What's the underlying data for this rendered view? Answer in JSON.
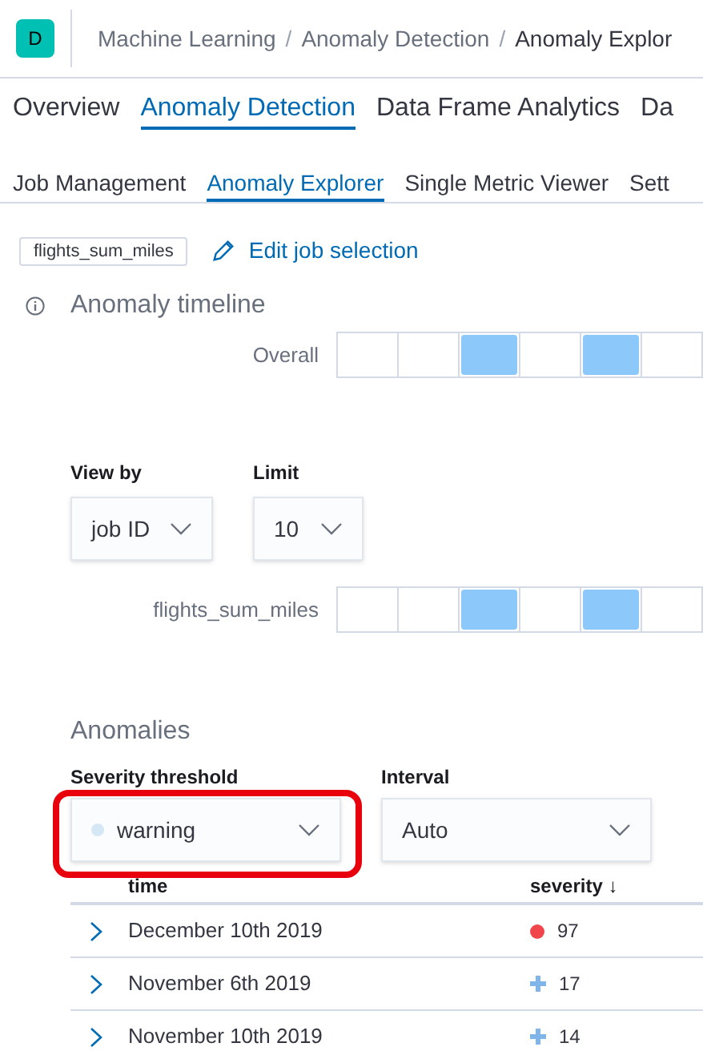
{
  "header": {
    "avatar": "D",
    "separator": "/",
    "breadcrumbs": [
      "Machine Learning",
      "Anomaly Detection",
      "Anomaly Explor"
    ]
  },
  "tabs": [
    {
      "label": "Overview",
      "selected": false
    },
    {
      "label": "Anomaly Detection",
      "selected": true
    },
    {
      "label": "Data Frame Analytics",
      "selected": false
    },
    {
      "label": "Da",
      "selected": false
    }
  ],
  "subtabs": [
    {
      "label": "Job Management",
      "selected": false
    },
    {
      "label": "Anomaly Explorer",
      "selected": true
    },
    {
      "label": "Single Metric Viewer",
      "selected": false
    },
    {
      "label": "Sett",
      "selected": false
    }
  ],
  "job_selection": {
    "job": "flights_sum_miles",
    "edit_link": "Edit job selection"
  },
  "timeline": {
    "title": "Anomaly timeline",
    "overall": {
      "label": "Overall",
      "cells": [
        {
          "anomaly": false
        },
        {
          "anomaly": false
        },
        {
          "anomaly": true
        },
        {
          "anomaly": false
        },
        {
          "anomaly": true
        },
        {
          "anomaly": false
        }
      ]
    },
    "view_by": {
      "label": "View by",
      "value": "job ID"
    },
    "limit": {
      "label": "Limit",
      "value": "10"
    },
    "swimlanes": [
      {
        "label": "flights_sum_miles",
        "cells": [
          {
            "anomaly": false
          },
          {
            "anomaly": false
          },
          {
            "anomaly": true
          },
          {
            "anomaly": false
          },
          {
            "anomaly": true
          },
          {
            "anomaly": false
          }
        ]
      }
    ]
  },
  "anomalies": {
    "title": "Anomalies",
    "severity_threshold": {
      "label": "Severity threshold",
      "value": "warning",
      "color": "#d6e8f5",
      "highlighted": true
    },
    "interval": {
      "label": "Interval",
      "value": "Auto"
    },
    "table": {
      "columns": [
        "time",
        "severity ↓"
      ],
      "rows": [
        {
          "time": "December 10th 2019",
          "severity": "97",
          "kind": "dot",
          "color": "#f0464b"
        },
        {
          "time": "November 6th 2019",
          "severity": "17",
          "kind": "cross",
          "color": "#7fb5e8"
        },
        {
          "time": "November 10th 2019",
          "severity": "14",
          "kind": "cross",
          "color": "#7fb5e8"
        }
      ]
    }
  }
}
